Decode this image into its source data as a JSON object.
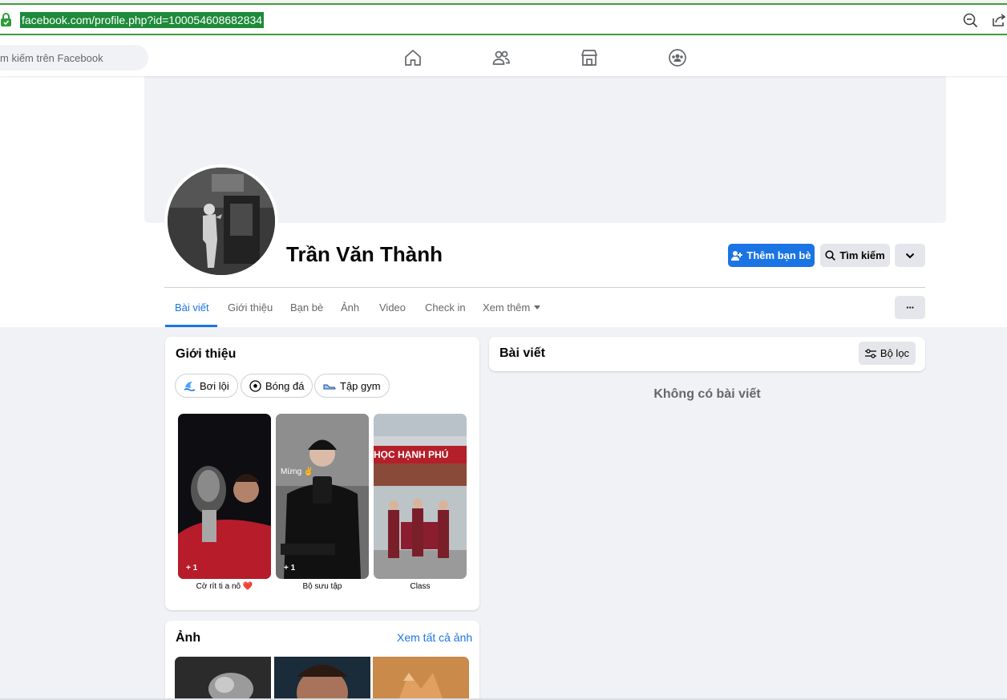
{
  "browser": {
    "url": "facebook.com/profile.php?id=100054608682834",
    "icons": [
      "lock-icon",
      "zoom-out-icon",
      "share-icon"
    ]
  },
  "header": {
    "search_placeholder": "m kiếm trên Facebook",
    "nav_icons": [
      "home-icon",
      "friends-icon",
      "marketplace-icon",
      "groups-icon"
    ]
  },
  "profile": {
    "name": "Trần Văn Thành",
    "add_friend_label": "Thêm bạn bè",
    "search_label": "Tìm kiếm",
    "more_icon": "chevron-down-icon"
  },
  "tabs": [
    {
      "label": "Bài viết",
      "active": true
    },
    {
      "label": "Giới thiệu",
      "active": false
    },
    {
      "label": "Bạn bè",
      "active": false
    },
    {
      "label": "Ảnh",
      "active": false
    },
    {
      "label": "Video",
      "active": false
    },
    {
      "label": "Check in",
      "active": false
    },
    {
      "label": "Xem thêm",
      "active": false
    }
  ],
  "tab_more_label": "···",
  "intro": {
    "title": "Giới thiệu",
    "hobbies": [
      {
        "label": "Bơi lội",
        "icon": "swimming-icon"
      },
      {
        "label": "Bóng đá",
        "icon": "soccer-ball-icon"
      },
      {
        "label": "Tập gym",
        "icon": "shoe-icon"
      }
    ],
    "featured": [
      {
        "label": "Cờ rít ti a nô ❤️",
        "count": "+ 1"
      },
      {
        "label": "Bộ sưu tập",
        "count": "+ 1",
        "overlay": "Mừng ✌️"
      },
      {
        "label": "Class",
        "count": "",
        "overlay": "HỌC HẠNH PHÚ"
      }
    ]
  },
  "photos": {
    "title": "Ảnh",
    "see_all": "Xem tất cả ảnh"
  },
  "posts": {
    "title": "Bài viết",
    "filter_label": "Bộ lọc",
    "empty": "Không có bài viết"
  },
  "colors": {
    "primary": "#1b74e4",
    "bg": "#f0f2f5",
    "url_highlight": "#1e8a3a"
  }
}
